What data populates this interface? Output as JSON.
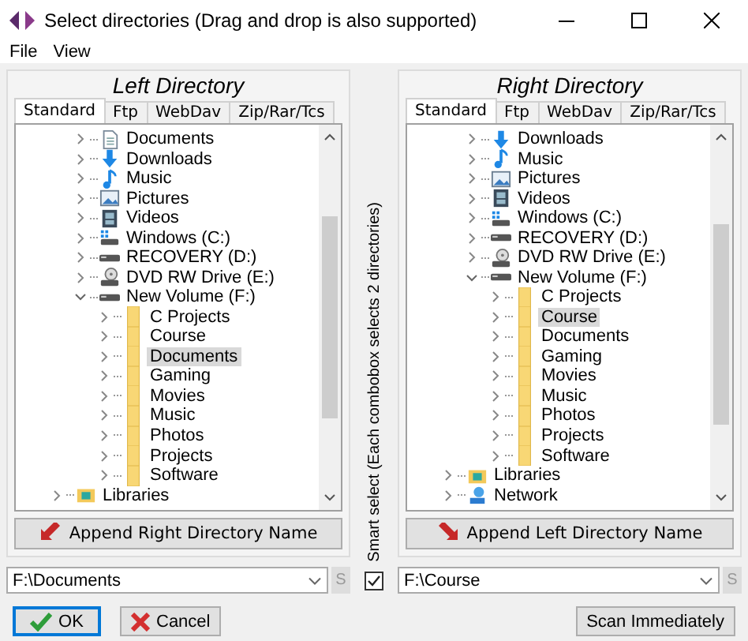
{
  "window": {
    "title": "Select directories (Drag and drop is also supported)"
  },
  "menu": [
    "File",
    "View"
  ],
  "panels": [
    {
      "heading": "Left Directory",
      "tabs": [
        {
          "label": "Standard",
          "selected": true
        },
        {
          "label": "Ftp",
          "selected": false
        },
        {
          "label": "WebDav",
          "selected": false
        },
        {
          "label": "Zip/Rar/Tcs",
          "selected": false
        }
      ],
      "tree": {
        "nodes": [
          {
            "label": "Documents",
            "kind": "documents",
            "expanded": false,
            "selected": false
          },
          {
            "label": "Downloads",
            "kind": "downloads",
            "expanded": false,
            "selected": false
          },
          {
            "label": "Music",
            "kind": "music",
            "expanded": false,
            "selected": false
          },
          {
            "label": "Pictures",
            "kind": "pictures",
            "expanded": false,
            "selected": false
          },
          {
            "label": "Videos",
            "kind": "videos",
            "expanded": false,
            "selected": false
          },
          {
            "label": "Windows (C:)",
            "kind": "system-drive",
            "expanded": false,
            "selected": false
          },
          {
            "label": "RECOVERY (D:)",
            "kind": "drive",
            "expanded": false,
            "selected": false
          },
          {
            "label": "DVD RW Drive (E:)",
            "kind": "dvd",
            "expanded": false,
            "selected": false
          },
          {
            "label": "New Volume (F:)",
            "kind": "drive",
            "expanded": true,
            "selected": false,
            "children": [
              {
                "label": "C Projects",
                "kind": "folder",
                "expanded": false,
                "selected": false
              },
              {
                "label": "Course",
                "kind": "folder",
                "expanded": false,
                "selected": false
              },
              {
                "label": "Documents",
                "kind": "folder",
                "expanded": false,
                "selected": true
              },
              {
                "label": "Gaming",
                "kind": "folder",
                "expanded": false,
                "selected": false
              },
              {
                "label": "Movies",
                "kind": "folder",
                "expanded": false,
                "selected": false
              },
              {
                "label": "Music",
                "kind": "folder",
                "expanded": false,
                "selected": false
              },
              {
                "label": "Photos",
                "kind": "folder",
                "expanded": false,
                "selected": false
              },
              {
                "label": "Projects",
                "kind": "folder",
                "expanded": false,
                "selected": false
              },
              {
                "label": "Software",
                "kind": "folder",
                "expanded": false,
                "selected": false
              }
            ]
          }
        ],
        "trailing_nodes": [
          {
            "label": "Libraries",
            "kind": "libraries",
            "expanded": false,
            "selected": false
          }
        ]
      },
      "append_button": "Append Right Directory Name",
      "path": {
        "value": "F:\\Documents"
      },
      "s_button": "S"
    },
    {
      "heading": "Right Directory",
      "tabs": [
        {
          "label": "Standard",
          "selected": true
        },
        {
          "label": "Ftp",
          "selected": false
        },
        {
          "label": "WebDav",
          "selected": false
        },
        {
          "label": "Zip/Rar/Tcs",
          "selected": false
        }
      ],
      "tree": {
        "nodes": [
          {
            "label": "Downloads",
            "kind": "downloads",
            "expanded": false,
            "selected": false
          },
          {
            "label": "Music",
            "kind": "music",
            "expanded": false,
            "selected": false
          },
          {
            "label": "Pictures",
            "kind": "pictures",
            "expanded": false,
            "selected": false
          },
          {
            "label": "Videos",
            "kind": "videos",
            "expanded": false,
            "selected": false
          },
          {
            "label": "Windows (C:)",
            "kind": "system-drive",
            "expanded": false,
            "selected": false
          },
          {
            "label": "RECOVERY (D:)",
            "kind": "drive",
            "expanded": false,
            "selected": false
          },
          {
            "label": "DVD RW Drive (E:)",
            "kind": "dvd",
            "expanded": false,
            "selected": false
          },
          {
            "label": "New Volume (F:)",
            "kind": "drive",
            "expanded": true,
            "selected": false,
            "children": [
              {
                "label": "C Projects",
                "kind": "folder",
                "expanded": false,
                "selected": false
              },
              {
                "label": "Course",
                "kind": "folder",
                "expanded": false,
                "selected": true
              },
              {
                "label": "Documents",
                "kind": "folder",
                "expanded": false,
                "selected": false
              },
              {
                "label": "Gaming",
                "kind": "folder",
                "expanded": false,
                "selected": false
              },
              {
                "label": "Movies",
                "kind": "folder",
                "expanded": false,
                "selected": false
              },
              {
                "label": "Music",
                "kind": "folder",
                "expanded": false,
                "selected": false
              },
              {
                "label": "Photos",
                "kind": "folder",
                "expanded": false,
                "selected": false
              },
              {
                "label": "Projects",
                "kind": "folder",
                "expanded": false,
                "selected": false
              },
              {
                "label": "Software",
                "kind": "folder",
                "expanded": false,
                "selected": false
              }
            ]
          }
        ],
        "trailing_nodes": [
          {
            "label": "Libraries",
            "kind": "libraries",
            "expanded": false,
            "selected": false
          },
          {
            "label": "Network",
            "kind": "network",
            "expanded": false,
            "selected": false
          }
        ]
      },
      "append_button": "Append Left Directory Name",
      "path": {
        "value": "F:\\Course"
      },
      "s_button": "S"
    }
  ],
  "smart_select": {
    "label": "Smart select (Each combobox selects 2 directories)",
    "checked": true
  },
  "buttons": [
    {
      "label": "OK",
      "kind": "ok",
      "focused": true
    },
    {
      "label": "Cancel",
      "kind": "cancel",
      "focused": false
    }
  ],
  "scan_button": "Scan Immediately"
}
